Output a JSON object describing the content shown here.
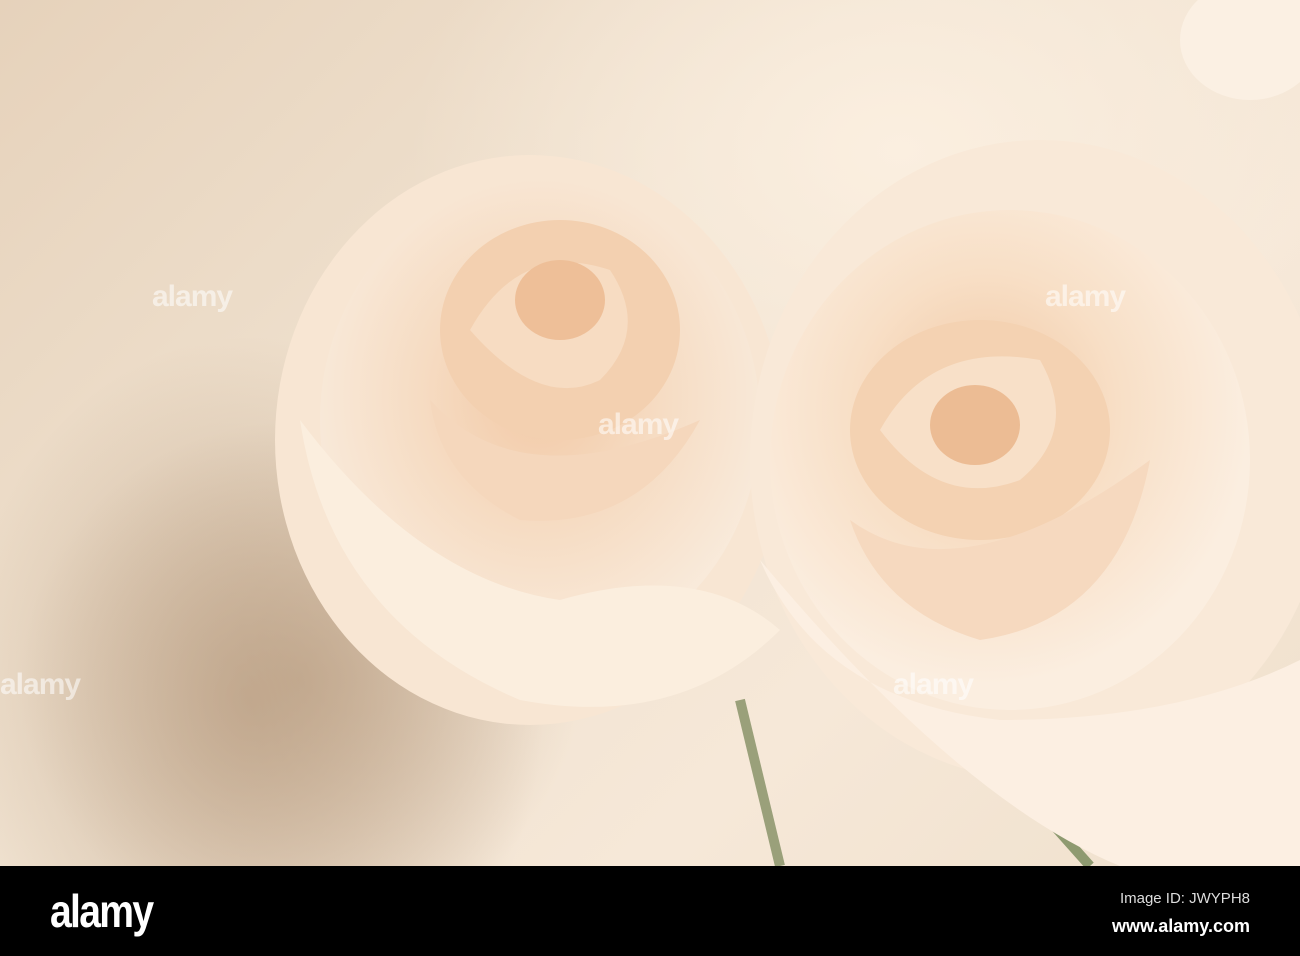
{
  "watermark": {
    "text": "alamy"
  },
  "footer": {
    "logo": "alamy",
    "image_id": "Image ID: JWYPH8",
    "website": "www.alamy.com"
  },
  "colors": {
    "petal": "#f7e2cc",
    "petal_shadow": "#e8c4a4",
    "wall": "#ecdcc8",
    "bar": "#000000"
  }
}
